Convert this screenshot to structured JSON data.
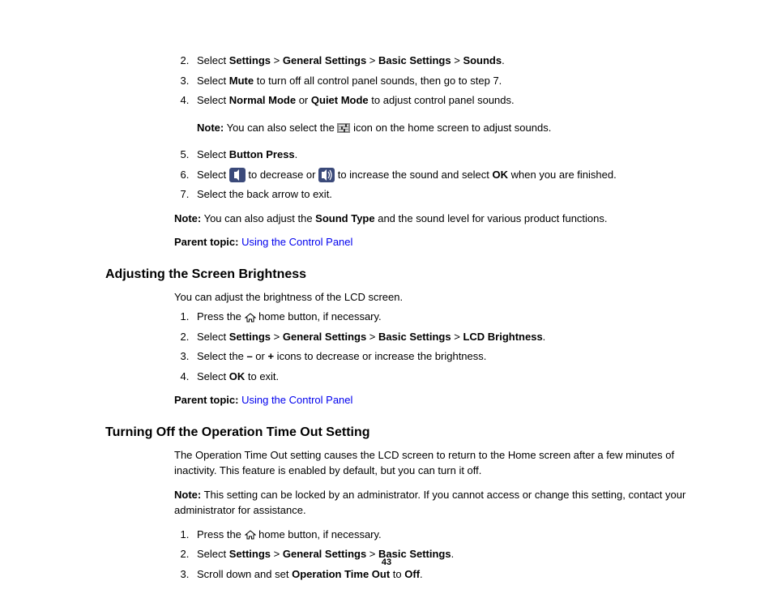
{
  "sec1": {
    "li2": {
      "prefix": "Select ",
      "b1": "Settings",
      "gt1": " > ",
      "b2": "General Settings",
      "gt2": " > ",
      "b3": "Basic Settings",
      "gt3": " > ",
      "b4": "Sounds",
      "suffix": "."
    },
    "li3": {
      "prefix": "Select ",
      "b1": "Mute",
      "suffix": " to turn off all control panel sounds, then go to step 7."
    },
    "li4": {
      "prefix": "Select ",
      "b1": "Normal Mode",
      "mid": " or ",
      "b2": "Quiet Mode",
      "suffix": " to adjust control panel sounds."
    },
    "note1": {
      "label": "Note:",
      "t1": " You can also select the ",
      "t2": " icon on the home screen to adjust sounds."
    },
    "li5": {
      "prefix": "Select ",
      "b1": "Button Press",
      "suffix": "."
    },
    "li6": {
      "prefix": "Select ",
      "mid1": " to decrease or ",
      "mid2": " to increase the sound and select ",
      "b1": "OK",
      "suffix": " when you are finished."
    },
    "li7": "Select the back arrow to exit.",
    "note2": {
      "label": "Note:",
      "t1": " You can also adjust the ",
      "b1": "Sound Type",
      "t2": " and the sound level for various product functions."
    },
    "parent": {
      "label": "Parent topic:",
      "link": "Using the Control Panel"
    }
  },
  "sec2": {
    "heading": "Adjusting the Screen Brightness",
    "intro": "You can adjust the brightness of the LCD screen.",
    "li1": {
      "t1": "Press the ",
      "t2": " home button, if necessary."
    },
    "li2": {
      "prefix": "Select ",
      "b1": "Settings",
      "gt1": " > ",
      "b2": "General Settings",
      "gt2": " > ",
      "b3": "Basic Settings",
      "gt3": " > ",
      "b4": "LCD Brightness",
      "suffix": "."
    },
    "li3": {
      "t1": "Select the ",
      "b1": "–",
      "t2": " or ",
      "b2": "+",
      "t3": " icons to decrease or increase the brightness."
    },
    "li4": {
      "t1": "Select ",
      "b1": "OK",
      "t2": " to exit."
    },
    "parent": {
      "label": "Parent topic:",
      "link": "Using the Control Panel"
    }
  },
  "sec3": {
    "heading": "Turning Off the Operation Time Out Setting",
    "intro": "The Operation Time Out setting causes the LCD screen to return to the Home screen after a few minutes of inactivity. This feature is enabled by default, but you can turn it off.",
    "note": {
      "label": "Note:",
      "text": " This setting can be locked by an administrator. If you cannot access or change this setting, contact your administrator for assistance."
    },
    "li1": {
      "t1": "Press the ",
      "t2": " home button, if necessary."
    },
    "li2": {
      "prefix": "Select ",
      "b1": "Settings",
      "gt1": " > ",
      "b2": "General Settings",
      "gt2": " > ",
      "b3": "Basic Settings",
      "suffix": "."
    },
    "li3": {
      "t1": "Scroll down and set ",
      "b1": "Operation Time Out",
      "t2": " to ",
      "b2": "Off",
      "t3": "."
    }
  },
  "page_number": "43"
}
